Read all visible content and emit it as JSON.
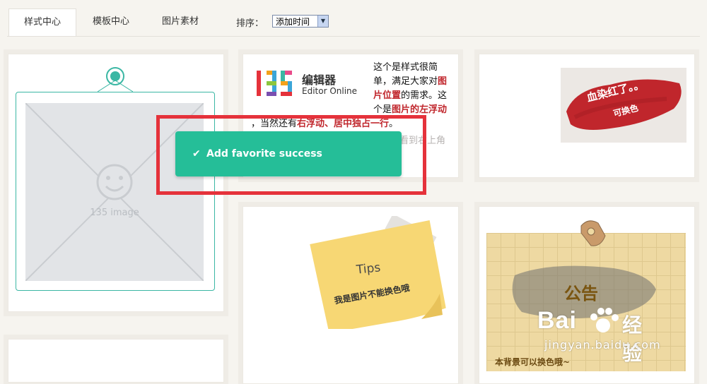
{
  "tabs": [
    {
      "label": "样式中心",
      "active": true
    },
    {
      "label": "模板中心",
      "active": false
    },
    {
      "label": "图片素材",
      "active": false
    }
  ],
  "sort": {
    "label": "排序：",
    "selected": "添加时间"
  },
  "card1": {
    "placeholder_label": "135 image"
  },
  "card2": {
    "logo_name": "编辑器",
    "logo_en": "Editor Online",
    "desc_1": "这个是样式很简单，满足大家对",
    "desc_red_1": "图片位置",
    "desc_2": "的需求。这个是",
    "desc_red_2": "图片的左浮动",
    "desc_3": "，当然还有",
    "desc_red_3": "右浮动、居中独占一行",
    "desc_4": "。",
    "faint_text": "如何修改浮动方式？双击图片，看到右上角浮动设置，自己选择吧"
  },
  "card3": {
    "brush_title": "血染红了。。",
    "brush_sub": "可换色"
  },
  "card5": {
    "tips_title": "Tips",
    "tips_text": "我是图片不能换色哦"
  },
  "card6": {
    "notice_title": "公告",
    "notice_text": "本背景可以换色哦~"
  },
  "toast": {
    "icon": "check-icon",
    "message": "Add favorite success"
  },
  "watermark": {
    "brand": "Bai",
    "brand_cn": "经验",
    "url": "jingyan.baidu.com"
  },
  "colors": {
    "accent": "#25be98",
    "frame": "#3bb7a4",
    "highlight": "#e5323b",
    "text_red": "#c0262c"
  }
}
